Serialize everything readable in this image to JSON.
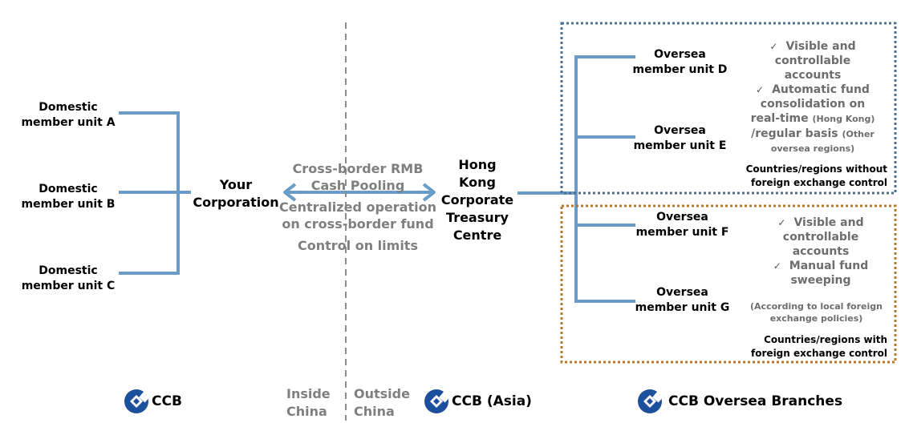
{
  "domestic_units": [
    {
      "line1": "Domestic",
      "line2": "member unit A"
    },
    {
      "line1": "Domestic",
      "line2": "member unit B"
    },
    {
      "line1": "Domestic",
      "line2": "member unit C"
    }
  ],
  "your_corporation": {
    "line1": "Your",
    "line2": "Corporation"
  },
  "cross_border": {
    "line1": "Cross-border RMB",
    "line2": "Cash Pooling",
    "line3": "Centralized operation",
    "line4": "on cross-border fund",
    "line5": "Control on limits"
  },
  "hk_centre": {
    "line1": "Hong",
    "line2": "Kong",
    "line3": "Corporate",
    "line4": "Treasury",
    "line5": "Centre"
  },
  "oversea_units": [
    {
      "line1": "Oversea",
      "line2": "member unit D"
    },
    {
      "line1": "Oversea",
      "line2": "member unit E"
    },
    {
      "line1": "Oversea",
      "line2": "member unit F"
    },
    {
      "line1": "Oversea",
      "line2": "member unit G"
    }
  ],
  "no_control_features": {
    "check_glyph": "✓",
    "item1": [
      "Visible and",
      "controllable",
      "accounts"
    ],
    "item2_l1": "Automatic fund",
    "item2_l2": "consolidation on",
    "item2_l3a": "real-time",
    "item2_l3b": "(Hong Kong)",
    "item2_l4a": "/regular basis",
    "item2_l4b": "(Other",
    "item2_l5": "oversea regions)"
  },
  "no_control_region": {
    "line1": "Countries/regions without",
    "line2": "foreign exchange control"
  },
  "control_features": {
    "check_glyph": "✓",
    "item1": [
      "Visible and",
      "controllable",
      "accounts"
    ],
    "item2": [
      "Manual fund",
      "sweeping"
    ],
    "note1": "(According to local foreign",
    "note2": "exchange policies)"
  },
  "control_region": {
    "line1": "Countries/regions with",
    "line2": "foreign exchange control"
  },
  "zones": {
    "inside": [
      "Inside",
      "China"
    ],
    "outside": [
      "Outside",
      "China"
    ]
  },
  "logos": {
    "ccb": "CCB",
    "ccb_asia": "CCB (Asia)",
    "ccb_oversea": "CCB Oversea Branches"
  },
  "colors": {
    "connector": "#6a9bc9",
    "no_control_border": "#4f6f8f",
    "control_border": "#b8782a",
    "divider": "#8c8c8c",
    "logo_blue": "#1c4f9c"
  }
}
